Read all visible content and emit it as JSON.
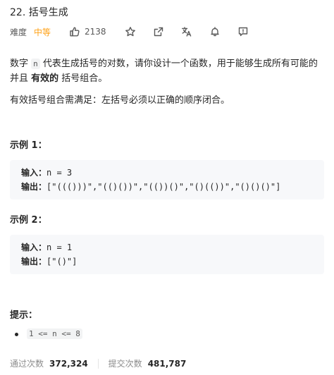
{
  "problem": {
    "title": "22. 括号生成",
    "difficulty_label": "难度",
    "difficulty": "中等",
    "likes": "2138"
  },
  "description": {
    "p1_before": "数字 ",
    "p1_code": "n",
    "p1_after": " 代表生成括号的对数，请你设计一个函数，用于能够生成所有可能的并且 ",
    "p1_bold": "有效的",
    "p1_end": " 括号组合。",
    "p2": "有效括号组合需满足：左括号必须以正确的顺序闭合。"
  },
  "examples": [
    {
      "title": "示例 1：",
      "input_label": "输入：",
      "input_value": "n = 3",
      "output_label": "输出：",
      "output_value": "[\"((()))\",\"(()())\",\"(())()\",\"()(())\",\"()()()\"]"
    },
    {
      "title": "示例 2：",
      "input_label": "输入：",
      "input_value": "n = 1",
      "output_label": "输出：",
      "output_value": "[\"()\"]"
    }
  ],
  "hints": {
    "title": "提示：",
    "items": [
      "1 <= n <= 8"
    ]
  },
  "stats": {
    "accepted_label": "通过次数",
    "accepted_value": "372,324",
    "submissions_label": "提交次数",
    "submissions_value": "481,787"
  },
  "icons": {
    "like": "thumbs-up-icon",
    "favorite": "star-icon",
    "share": "share-icon",
    "translate": "translate-icon",
    "notify": "bell-icon",
    "feedback": "feedback-icon"
  }
}
